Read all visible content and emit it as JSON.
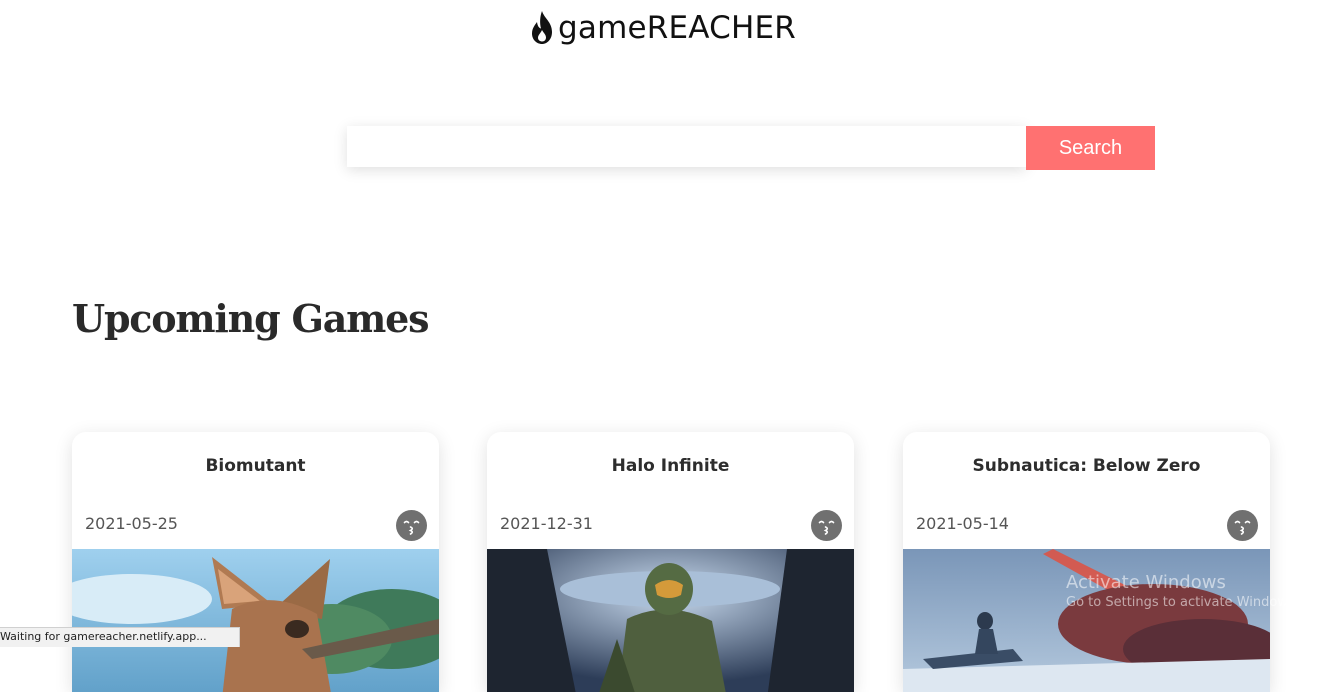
{
  "header": {
    "brand": "gameREACHER",
    "logo_icon": "flame-icon"
  },
  "search": {
    "value": "",
    "placeholder": "",
    "button_label": "Search"
  },
  "section": {
    "title": "Upcoming Games"
  },
  "games": [
    {
      "title": "Biomutant",
      "release_date": "2021-05-25",
      "icon": "kissing-face-icon"
    },
    {
      "title": "Halo Infinite",
      "release_date": "2021-12-31",
      "icon": "kissing-face-icon"
    },
    {
      "title": "Subnautica: Below Zero",
      "release_date": "2021-05-14",
      "icon": "kissing-face-icon"
    }
  ],
  "overlay": {
    "watermark_line1": "Activate Windows",
    "watermark_line2": "Go to Settings to activate Windows."
  },
  "status_bar": {
    "text": "Waiting for gamereacher.netlify.app..."
  },
  "colors": {
    "accent": "#ff7171",
    "icon_bg": "#707070",
    "text_dark": "#2a2a2a"
  }
}
